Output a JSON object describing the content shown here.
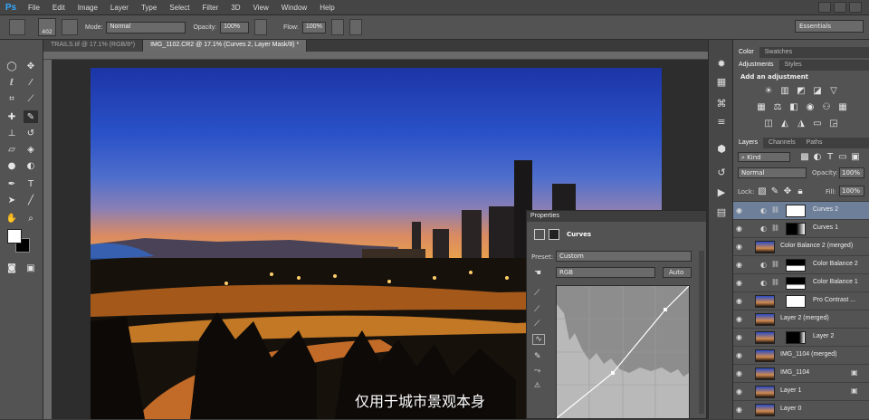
{
  "app": {
    "logo": "Ps"
  },
  "menu": [
    "File",
    "Edit",
    "Image",
    "Layer",
    "Type",
    "Select",
    "Filter",
    "3D",
    "View",
    "Window",
    "Help"
  ],
  "options": {
    "brush_size": "402",
    "mode_label": "Mode:",
    "mode_value": "Normal",
    "opacity_label": "Opacity:",
    "opacity_value": "100%",
    "flow_label": "Flow:",
    "flow_value": "100%",
    "workspace": "Essentials"
  },
  "tabs": [
    {
      "label": "TRAILS.tif @ 17.1% (RGB/8*)"
    },
    {
      "label": "IMG_1102.CR2 @ 17.1% (Curves 2, Layer Mask/8) *"
    }
  ],
  "properties": {
    "title": "Properties",
    "adjustment": "Curves",
    "preset_label": "Preset:",
    "preset_value": "Custom",
    "channel": "RGB",
    "auto_button": "Auto"
  },
  "panels": {
    "color_tabs": [
      "Color",
      "Swatches"
    ],
    "adj_tabs": [
      "Adjustments",
      "Styles"
    ],
    "add_adjustment": "Add an adjustment",
    "layer_tabs": [
      "Layers",
      "Channels",
      "Paths"
    ],
    "kind_filter": "Kind",
    "blend_mode": "Normal",
    "opacity_label": "Opacity:",
    "opacity_value": "100%",
    "lock_label": "Lock:",
    "fill_label": "Fill:",
    "fill_value": "100%",
    "layers": [
      {
        "name": "Curves 2",
        "selected": true
      },
      {
        "name": "Curves 1",
        "selected": false
      },
      {
        "name": "Color Balance 2 (merged)",
        "selected": false
      },
      {
        "name": "Color Balance 2",
        "selected": false
      },
      {
        "name": "Color Balance 1",
        "selected": false
      },
      {
        "name": "Pro Contrast ...",
        "selected": false
      },
      {
        "name": "Layer 2 (merged)",
        "selected": false
      },
      {
        "name": "Layer 2",
        "selected": false
      },
      {
        "name": "IMG_1104 (merged)",
        "selected": false
      },
      {
        "name": "IMG_1104",
        "selected": false
      },
      {
        "name": "Layer 1",
        "selected": false
      },
      {
        "name": "Layer 0",
        "selected": false
      }
    ]
  },
  "caption": "仅用于城市景观本身"
}
